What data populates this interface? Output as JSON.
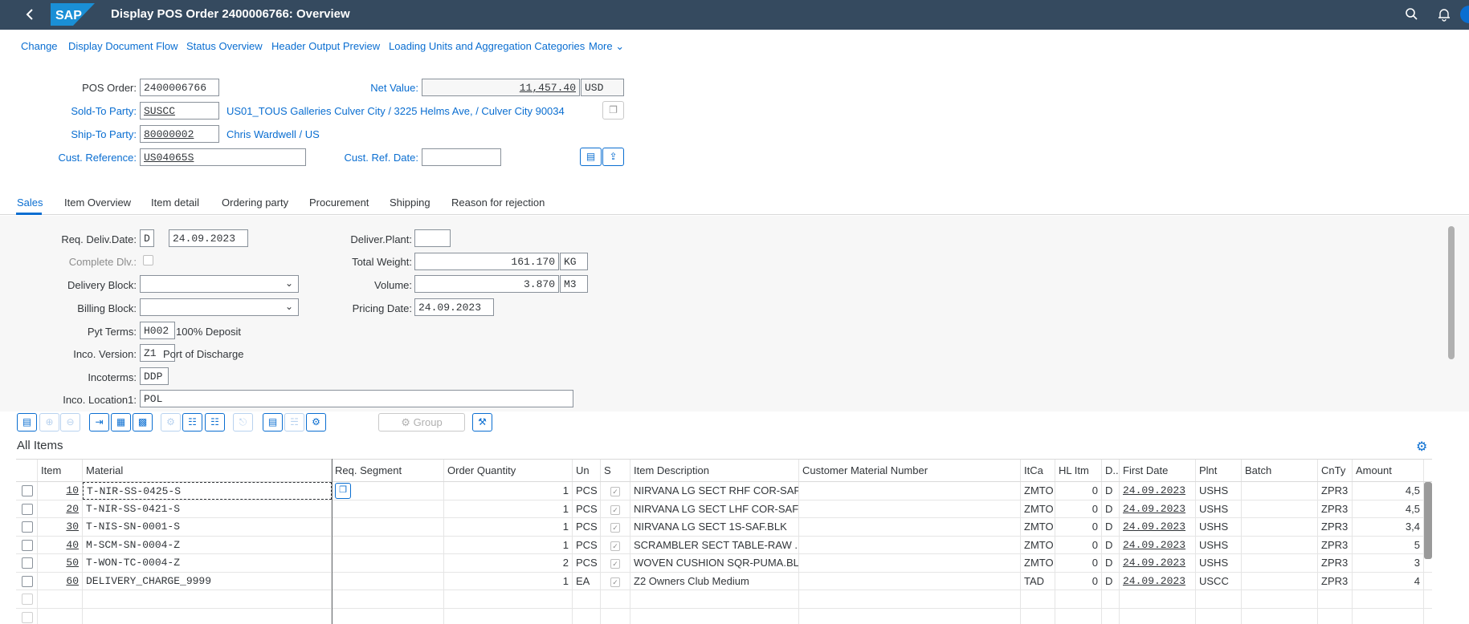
{
  "shell": {
    "title": "Display POS Order 2400006766: Overview",
    "logo_text": "SAP",
    "back_icon": "chevron-left-icon",
    "search_icon": "search-icon",
    "bell_icon": "bell-icon"
  },
  "toolbar": {
    "items": [
      "Change",
      "Display Document Flow",
      "Status Overview",
      "Header Output Preview",
      "Loading Units and Aggregation Categories",
      "More"
    ]
  },
  "header": {
    "pos_order_label": "POS Order:",
    "pos_order": "2400006766",
    "net_value_label": "Net Value:",
    "net_value": "11,457.40",
    "currency": "USD",
    "sold_to_label": "Sold-To Party:",
    "sold_to": "SUSCC",
    "sold_to_desc": "US01_TOUS Galleries Culver City / 3225 Helms Ave, / Culver City 90034",
    "ship_to_label": "Ship-To Party:",
    "ship_to": "80000002",
    "ship_to_desc": "Chris Wardwell / US",
    "cust_ref_label": "Cust. Reference:",
    "cust_ref": "US04065S",
    "cust_ref_date_label": "Cust. Ref. Date:",
    "cust_ref_date": ""
  },
  "tabs": [
    "Sales",
    "Item Overview",
    "Item detail",
    "Ordering party",
    "Procurement",
    "Shipping",
    "Reason for rejection"
  ],
  "sales": {
    "req_deliv_label": "Req. Deliv.Date:",
    "req_deliv_type": "D",
    "req_deliv_date": "24.09.2023",
    "complete_dlv_label": "Complete Dlv.:",
    "delivery_block_label": "Delivery Block:",
    "billing_block_label": "Billing Block:",
    "pyt_terms_label": "Pyt Terms:",
    "pyt_terms": "H002",
    "pyt_terms_desc": "100% Deposit",
    "inco_version_label": "Inco. Version:",
    "inco_version": "Z1",
    "inco_version_desc": "Port of Discharge",
    "incoterms_label": "Incoterms:",
    "incoterms": "DDP",
    "inco_loc_label": "Inco. Location1:",
    "inco_loc": "POL",
    "deliver_plant_label": "Deliver.Plant:",
    "deliver_plant": "",
    "total_weight_label": "Total Weight:",
    "total_weight": "161.170",
    "weight_unit": "KG",
    "volume_label": "Volume:",
    "volume": "3.870",
    "volume_unit": "M3",
    "pricing_date_label": "Pricing Date:",
    "pricing_date": "24.09.2023"
  },
  "items_toolbar": {
    "group_label": "Group"
  },
  "items": {
    "title": "All Items",
    "columns": [
      "Item",
      "Material",
      "Req. Segment",
      "Order Quantity",
      "Un",
      "S",
      "Item Description",
      "Customer Material Number",
      "ItCa",
      "HL Itm",
      "D..",
      "First Date",
      "Plnt",
      "Batch",
      "CnTy",
      "Amount"
    ],
    "rows": [
      {
        "item": "10",
        "material": "T-NIR-SS-0425-S",
        "qty": "1",
        "un": "PCS",
        "desc": "NIRVANA LG SECT RHF COR-SAF...",
        "itca": "ZMTO",
        "hl": "0",
        "d": "D",
        "date": "24.09.2023",
        "plnt": "USHS",
        "cnty": "ZPR3",
        "amount": "4,5"
      },
      {
        "item": "20",
        "material": "T-NIR-SS-0421-S",
        "qty": "1",
        "un": "PCS",
        "desc": "NIRVANA LG SECT LHF COR-SAF....",
        "itca": "ZMTO",
        "hl": "0",
        "d": "D",
        "date": "24.09.2023",
        "plnt": "USHS",
        "cnty": "ZPR3",
        "amount": "4,5"
      },
      {
        "item": "30",
        "material": "T-NIS-SN-0001-S",
        "qty": "1",
        "un": "PCS",
        "desc": "NIRVANA LG SECT 1S-SAF.BLK",
        "itca": "ZMTO",
        "hl": "0",
        "d": "D",
        "date": "24.09.2023",
        "plnt": "USHS",
        "cnty": "ZPR3",
        "amount": "3,4"
      },
      {
        "item": "40",
        "material": "M-SCM-SN-0004-Z",
        "qty": "1",
        "un": "PCS",
        "desc": "SCRAMBLER SECT TABLE-RAW ...",
        "itca": "ZMTO",
        "hl": "0",
        "d": "D",
        "date": "24.09.2023",
        "plnt": "USHS",
        "cnty": "ZPR3",
        "amount": "5"
      },
      {
        "item": "50",
        "material": "T-WON-TC-0004-Z",
        "qty": "2",
        "un": "PCS",
        "desc": "WOVEN CUSHION SQR-PUMA.BLK",
        "itca": "ZMTO",
        "hl": "0",
        "d": "D",
        "date": "24.09.2023",
        "plnt": "USHS",
        "cnty": "ZPR3",
        "amount": "3"
      },
      {
        "item": "60",
        "material": "DELIVERY_CHARGE_9999",
        "qty": "1",
        "un": "EA",
        "desc": "Z2 Owners Club Medium",
        "itca": "TAD",
        "hl": "0",
        "d": "D",
        "date": "24.09.2023",
        "plnt": "USCC",
        "cnty": "ZPR3",
        "amount": "4"
      }
    ]
  }
}
